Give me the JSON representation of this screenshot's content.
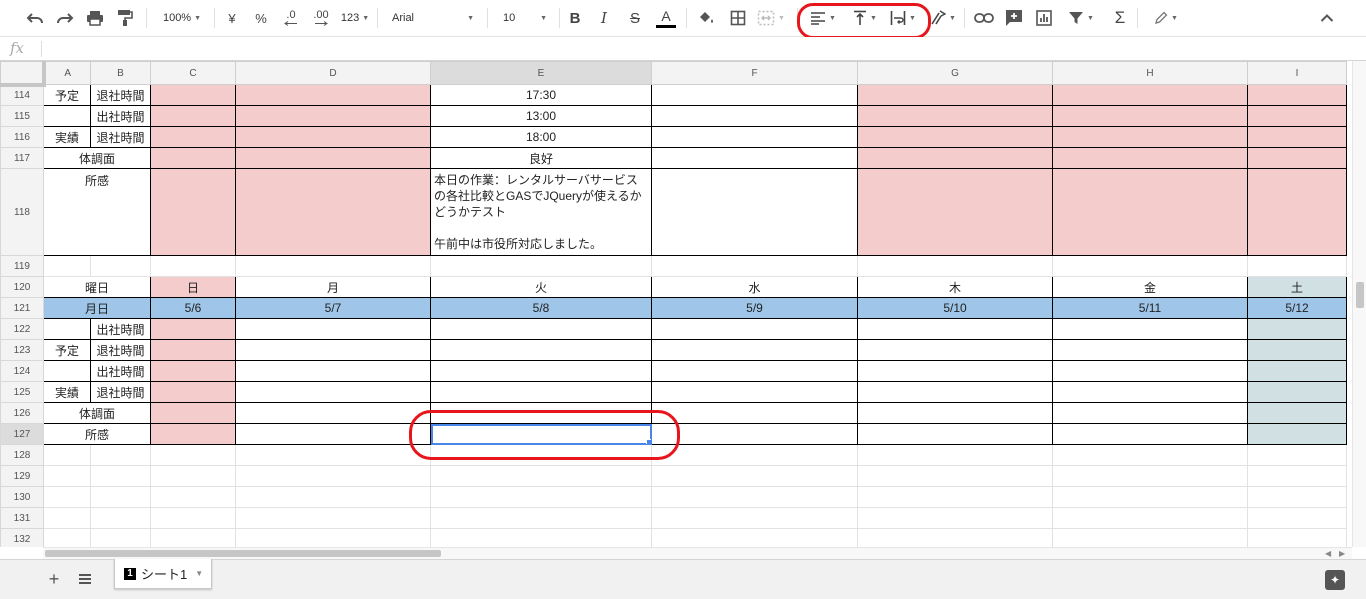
{
  "toolbar": {
    "zoom": "100%",
    "currency": "¥",
    "percent": "%",
    "dec_decrease": ".0",
    "dec_increase": ".00",
    "more_formats": "123",
    "font": "Arial",
    "font_size": "10",
    "bold": "B",
    "italic": "I",
    "strike": "S",
    "text_color": "A"
  },
  "formula_bar": {
    "fx_label": "fx",
    "value": ""
  },
  "columns": [
    "A",
    "B",
    "C",
    "D",
    "E",
    "F",
    "G",
    "H",
    "I"
  ],
  "rows": {
    "r114": {
      "num": "114",
      "a": "予定",
      "b": "退社時間",
      "e": "17:30"
    },
    "r115": {
      "num": "115",
      "b": "出社時間",
      "e": "13:00"
    },
    "r116": {
      "num": "116",
      "a": "実績",
      "b": "退社時間",
      "e": "18:00"
    },
    "r117": {
      "num": "117",
      "ab": "体調面",
      "e": "良好"
    },
    "r118": {
      "num": "118",
      "ab": "所感",
      "e_line1": "本日の作業：レンタルサーバサービスの各社比較とGASでJQueryが使えるかどうかテスト",
      "e_line2": "午前中は市役所対応しました。"
    },
    "r119": {
      "num": "119"
    },
    "r120": {
      "num": "120",
      "ab": "曜日",
      "c": "日",
      "d": "月",
      "e": "火",
      "f": "水",
      "g": "木",
      "h": "金",
      "i": "土"
    },
    "r121": {
      "num": "121",
      "ab": "月日",
      "c": "5/6",
      "d": "5/7",
      "e": "5/8",
      "f": "5/9",
      "g": "5/10",
      "h": "5/11",
      "i": "5/12"
    },
    "r122": {
      "num": "122",
      "b": "出社時間"
    },
    "r123": {
      "num": "123",
      "a": "予定",
      "b": "退社時間"
    },
    "r124": {
      "num": "124",
      "b": "出社時間"
    },
    "r125": {
      "num": "125",
      "a": "実績",
      "b": "退社時間"
    },
    "r126": {
      "num": "126",
      "ab": "体調面"
    },
    "r127": {
      "num": "127",
      "ab": "所感"
    },
    "r128": {
      "num": "128"
    },
    "r129": {
      "num": "129"
    },
    "r130": {
      "num": "130"
    },
    "r131": {
      "num": "131"
    },
    "r132": {
      "num": "132"
    }
  },
  "sheet_tab": {
    "number": "1",
    "name": "シート1"
  },
  "colors": {
    "pink": "#f4cccc",
    "blue": "#9fc5e8",
    "teal": "#d0e0e3",
    "selection": "#4a86e8",
    "annotation": "#e8161c"
  }
}
